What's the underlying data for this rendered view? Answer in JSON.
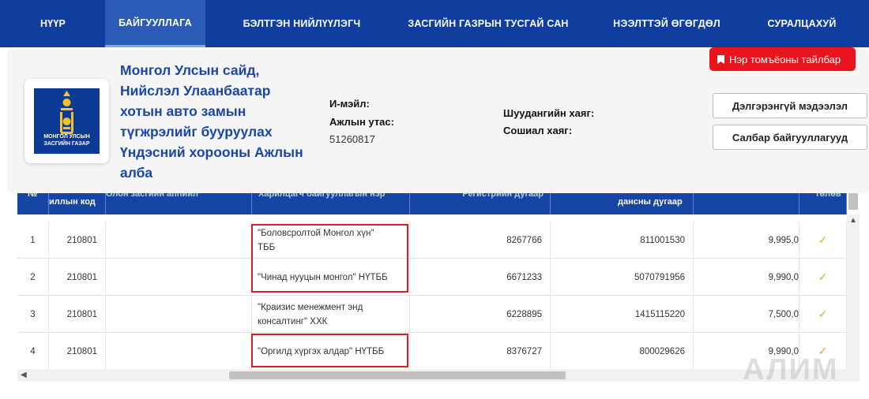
{
  "nav": {
    "items": [
      "НҮҮР",
      "БАЙГУУЛЛАГА",
      "БЭЛТГЭН НИЙЛҮҮЛЭГЧ",
      "ЗАСГИЙН ГАЗРЫН ТУСГАЙ САН",
      "НЭЭЛТТЭЙ ӨГӨГДӨЛ",
      "СУРАЛЦАХУЙ"
    ],
    "active": "БАЙГУУЛЛАГА"
  },
  "org": {
    "logo_text_1": "МОНГОЛ УЛСЫН",
    "logo_text_2": "ЗАСГИЙН ГАЗАР",
    "name_lines": [
      "Монгол Улсын сайд,",
      "Нийслэл Улаанбаатар",
      "хотын авто замын",
      "түгжрэлийг бууруулах",
      "Үндэсний хорооны Ажлын",
      "алба"
    ],
    "email_label": "И-мэйл:",
    "phone_label": "Ажлын утас:",
    "phone_value": "51260817",
    "web_label": "Шуудангийн хаяг:",
    "social_label": "Сошиал хаяг:",
    "legend_button": "Нэр томъёоны тайлбар",
    "details_button": "Дэлгэрэнгүй мэдээлэл",
    "branches_button": "Салбар байгууллагууд"
  },
  "table": {
    "headers": {
      "num": "№",
      "code": "иллын код",
      "approval": "Олон засгийн аппийл",
      "partner": "Харилцагч байгууллагын нэр",
      "reg": "Регистрийн дугаар",
      "account": "дансны дугаар",
      "amount": "",
      "status": "төлөв"
    },
    "rows": [
      {
        "num": "1",
        "code": "210801",
        "partner_line1": "\"Боловсролтой Монгол хүн\"",
        "partner_line2": "ТББ",
        "reg": "8267766",
        "account": "811001530",
        "amount": "9,995,0",
        "check": "✓"
      },
      {
        "num": "2",
        "code": "210801",
        "partner_line1": "\"Чинад нууцын монгол\" НҮТББ",
        "partner_line2": "",
        "reg": "6671233",
        "account": "5070791956",
        "amount": "9,990,0",
        "check": "✓"
      },
      {
        "num": "3",
        "code": "210801",
        "partner_line1": "\"Краизис менежмент энд",
        "partner_line2": "консалтинг\" ХХК",
        "reg": "6228895",
        "account": "1415115220",
        "amount": "7,500,0",
        "check": "✓"
      },
      {
        "num": "4",
        "code": "210801",
        "partner_line1": "\"Оргилд хүргэх алдар\" НҮТББ",
        "partner_line2": "",
        "reg": "8376727",
        "account": "800029626",
        "amount": "9,990,0",
        "check": "✓"
      }
    ]
  },
  "watermark": "АЛИМ"
}
